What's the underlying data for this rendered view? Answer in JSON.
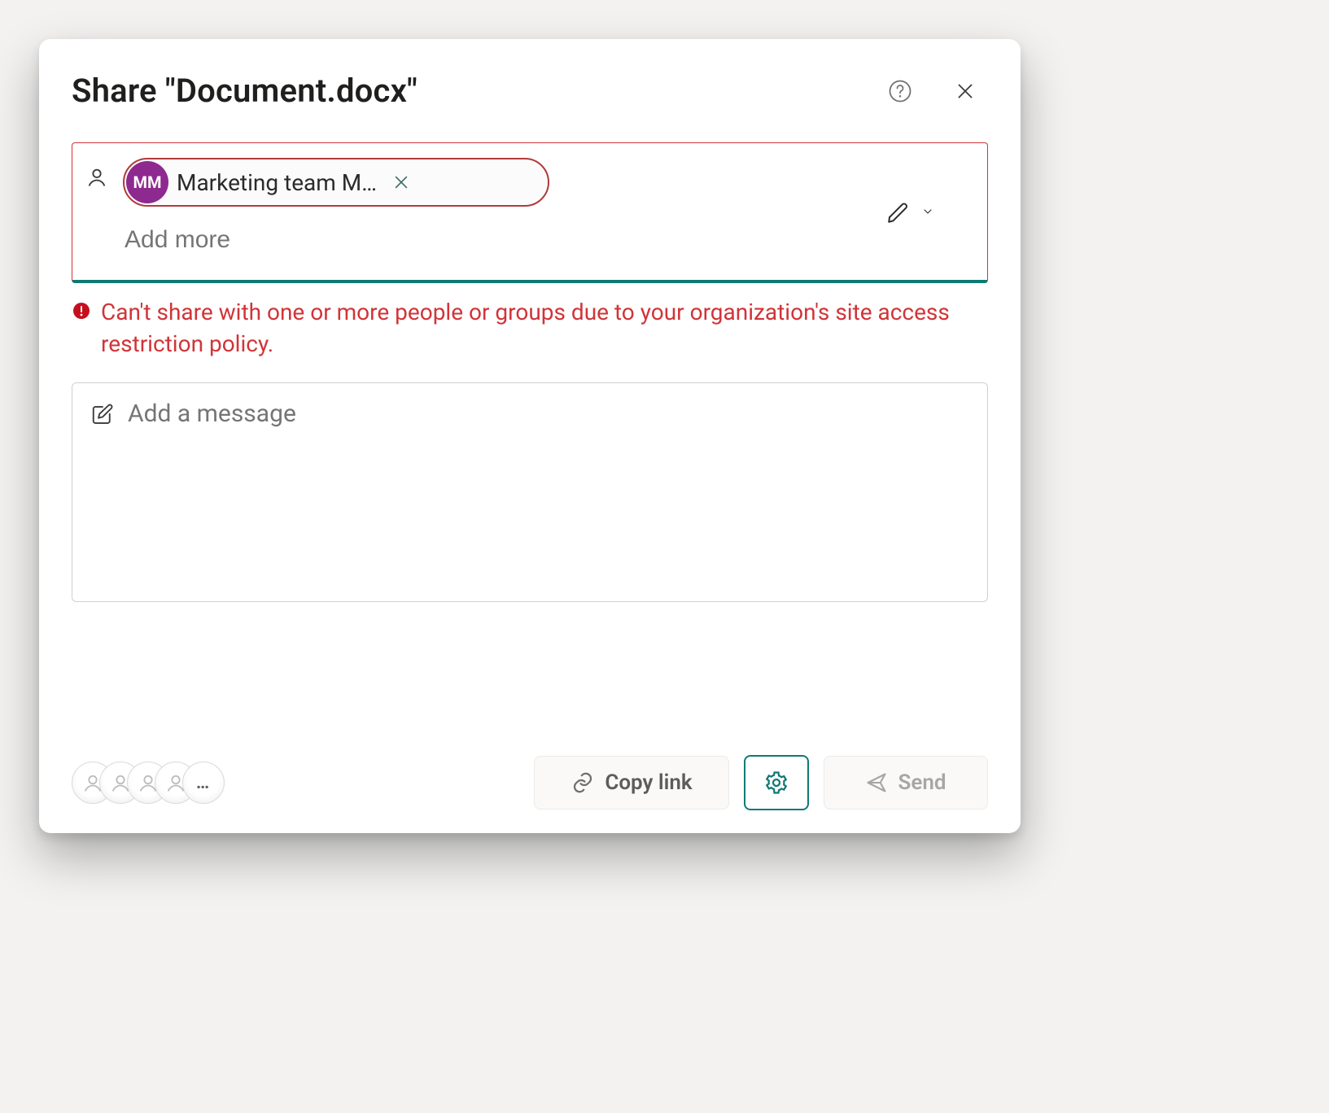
{
  "dialog": {
    "title": "Share \"Document.docx\""
  },
  "recipients": {
    "chip": {
      "initials": "MM",
      "label": "Marketing team M…",
      "ariaRemove": "Remove Marketing team"
    },
    "addMorePlaceholder": "Add more",
    "permissionAria": "Change permissions"
  },
  "error": {
    "text": "Can't share with one or more people or groups due to your organization's site access restriction policy."
  },
  "message": {
    "placeholder": "Add a message"
  },
  "footer": {
    "copy": "Copy link",
    "send": "Send",
    "avatarsMore": "…",
    "settingsAria": "Link settings",
    "sharedWithAria": "Manage access"
  },
  "icons": {
    "help": "help-icon",
    "close": "close-icon",
    "person": "person-icon",
    "removeX": "remove-icon",
    "pencil": "pencil-icon",
    "chevronDown": "chevron-down-icon",
    "errorCircle": "error-circle-icon",
    "compose": "compose-icon",
    "link": "link-icon",
    "gear": "gear-icon",
    "sendPlane": "send-icon"
  },
  "colors": {
    "error": "#d13438",
    "teal": "#0f7975",
    "chipAvatar": "#8e2990"
  }
}
